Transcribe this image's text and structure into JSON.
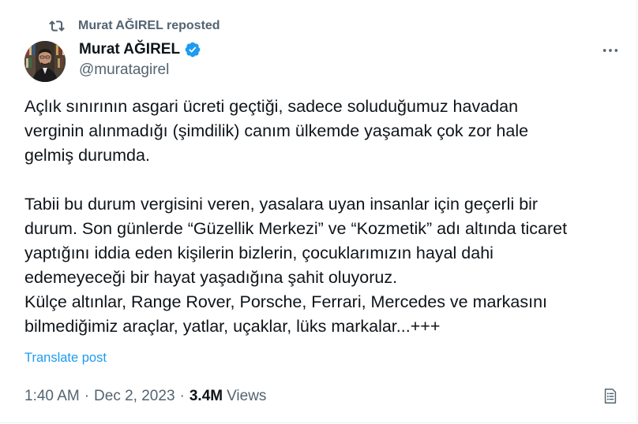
{
  "repost": {
    "label": "Murat AĞIREL reposted",
    "icon": "repost-icon"
  },
  "author": {
    "name": "Murat AĞIREL",
    "handle": "@muratagirel",
    "verified": true,
    "verified_color": "#1d9bf0"
  },
  "tweet": {
    "paragraph_1": "Açlık sınırının asgari ücreti geçtiği, sadece soluduğumuz havadan\nverginin alınmadığı (şimdilik) canım ülkemde yaşamak çok zor hale\ngelmiş durumda.",
    "paragraph_2": "Tabii bu durum vergisini veren, yasalara uyan insanlar için geçerli bir\ndurum. Son günlerde “Güzellik Merkezi” ve “Kozmetik” adı altında ticaret\nyaptığını iddia eden kişilerin bizlerin, çocuklarımızın hayal dahi\nedemeyeceği bir hayat yaşadığına şahit oluyoruz.\nKülçe altınlar, Range Rover, Porsche, Ferrari, Mercedes ve markasını\nbilmediğimiz araçlar, yatlar, uçaklar, lüks markalar...+++",
    "translate_label": "Translate post"
  },
  "meta": {
    "time": "1:40 AM",
    "date": "Dec 2, 2023",
    "separator": "·",
    "views_count": "3.4M",
    "views_label": "Views"
  },
  "icons": {
    "more": "more-icon",
    "analytics": "analytics-icon"
  },
  "colors": {
    "text_primary": "#0f1419",
    "text_secondary": "#536471",
    "link": "#1d9bf0"
  }
}
